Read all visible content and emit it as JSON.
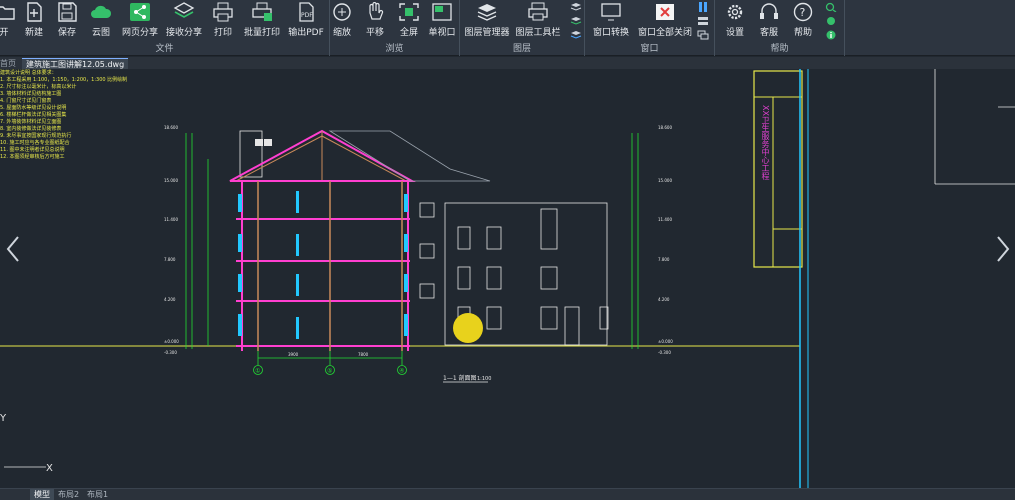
{
  "ribbon": {
    "groups": {
      "file": {
        "title": "文件",
        "buttons": [
          "开",
          "新建",
          "保存",
          "云图",
          "网页分享",
          "接收分享",
          "打印",
          "批量打印",
          "输出PDF"
        ]
      },
      "view": {
        "title": "浏览",
        "buttons": [
          "缩放",
          "平移",
          "全屏",
          "单视口"
        ]
      },
      "layer": {
        "title": "图层",
        "buttons": [
          "图层管理器",
          "图层工具栏"
        ]
      },
      "window": {
        "title": "窗口",
        "buttons": [
          "窗口转换",
          "窗口全部关闭"
        ]
      },
      "help": {
        "title": "帮助",
        "buttons": [
          "设置",
          "客服",
          "帮助"
        ]
      }
    }
  },
  "tabs": {
    "home": "首页",
    "active_file": "建筑施工图讲解12.05.dwg"
  },
  "layout_tabs": [
    "模型",
    "布局2",
    "布局1"
  ],
  "drawing": {
    "section_title": "1—1 剖面图",
    "scale": "1:100",
    "title_block": "XX卫生服务中心工程",
    "axis_labels": [
      "①",
      "⑤",
      "④"
    ],
    "ucs_y": "Y",
    "ucs_x": "X",
    "notes": [
      "建筑设计说明 总体要求：",
      "1. 本工程采用 1:100，1:150，1:200，1:300 比例绘制",
      "2. 尺寸标注以毫米计，标高以米计",
      "3. 墙体材料详见结构施工图",
      "4. 门窗尺寸详见门窗表",
      "5. 屋面防水等级详见设计说明",
      "6. 楼梯栏杆做法详见相关图集",
      "7. 外墙装饰材料详见立面图",
      "8. 室内装修做法详见装修表",
      "9. 未尽事宜按国家现行规范执行",
      "10. 施工时应与各专业图纸配合",
      "11. 图中未注明者详见总说明",
      "12. 本图须经审核后方可施工"
    ],
    "elevations_left": [
      "18.600",
      "15.000",
      "11.400",
      "7.800",
      "4.200",
      "±0.000",
      "-0.300"
    ],
    "elevations_right": [
      "18.600",
      "15.000",
      "11.400",
      "7.800",
      "4.200",
      "±0.000",
      "-0.300"
    ],
    "dimensions_bottom": [
      "3900",
      "7800"
    ]
  },
  "colors": {
    "ribbon_bg": "#2d3540",
    "canvas_bg": "#212830",
    "cad_green": "#22dd33",
    "cad_magenta": "#ff3fd0",
    "cad_yellow": "#e8e84a",
    "cad_cyan": "#22c8ff",
    "cad_white": "#e6e6e6"
  }
}
